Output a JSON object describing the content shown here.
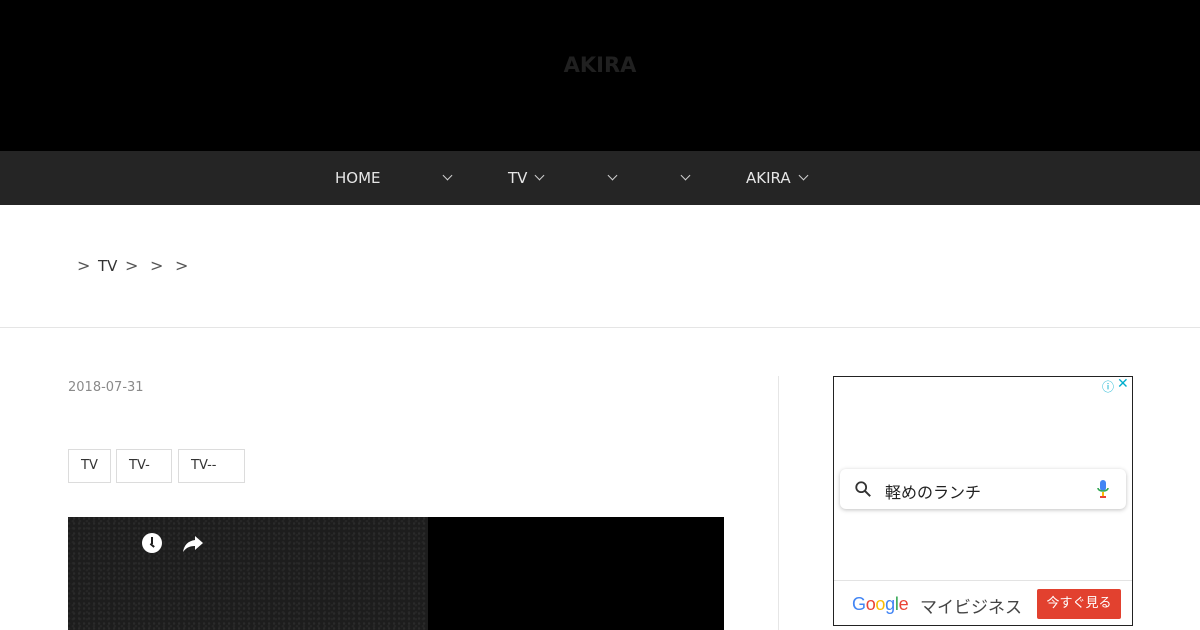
{
  "header": {
    "title_line1": "AKIRA",
    "title_line2": ""
  },
  "nav": {
    "items": [
      "HOME",
      "",
      "TV",
      "",
      "",
      "AKIRA"
    ]
  },
  "breadcrumb": {
    "items": [
      "TV",
      "",
      "",
      ""
    ],
    "separator": ">"
  },
  "post": {
    "date": "2018-07-31",
    "title": "",
    "tags": [
      "TV",
      "TV-",
      "TV--"
    ]
  },
  "ad": {
    "info_icon": "info-icon",
    "close_icon": "close-icon",
    "search_text": "軽めのランチ",
    "logo_text": [
      "G",
      "o",
      "o",
      "g",
      "l",
      "e"
    ],
    "logo_colors": [
      "#4285f4",
      "#ea4335",
      "#fbbc05",
      "#4285f4",
      "#34a853",
      "#ea4335"
    ],
    "brand_text": "マイビジネス",
    "cta_label": "今すぐ見る"
  },
  "colors": {
    "header_bg": "#000000",
    "nav_bg": "#252525",
    "cta_bg": "#e2412f"
  }
}
